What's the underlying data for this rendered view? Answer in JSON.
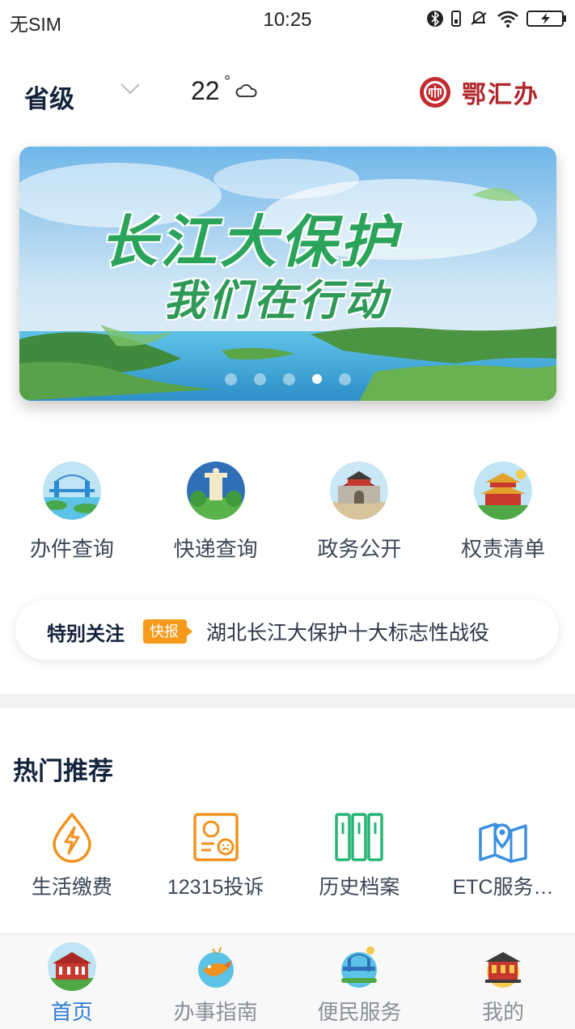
{
  "status_bar": {
    "carrier": "无SIM",
    "time": "10:25"
  },
  "header": {
    "region": "省级",
    "temperature": "22",
    "temperature_unit": "°",
    "weather_icon": "cloud-icon",
    "logo_text": "鄂汇办"
  },
  "banner": {
    "line1": "长江大保护",
    "line2": "我们在行动",
    "dot_count": 5,
    "active_dot": 4
  },
  "quick_services": [
    {
      "label": "办件查询",
      "icon": "bridge-illustration-icon"
    },
    {
      "label": "快递查询",
      "icon": "monument-illustration-icon"
    },
    {
      "label": "政务公开",
      "icon": "city-gate-illustration-icon"
    },
    {
      "label": "权责清单",
      "icon": "pavilion-illustration-icon"
    }
  ],
  "notice": {
    "label": "特别关注",
    "badge": "快报",
    "text": "湖北长江大保护十大标志性战役"
  },
  "hot_section": {
    "title": "热门推荐",
    "items": [
      {
        "label": "生活缴费",
        "icon": "utility-bolt-icon",
        "color": "#f0921f"
      },
      {
        "label": "12315投诉",
        "icon": "complaint-certificate-icon",
        "color": "#f0921f"
      },
      {
        "label": "历史档案",
        "icon": "archive-binders-icon",
        "color": "#27b573"
      },
      {
        "label": "ETC服务…",
        "icon": "map-pin-icon",
        "color": "#3b8fe0"
      }
    ]
  },
  "tab_bar": {
    "active_index": 0,
    "active_color": "#2e7bd6",
    "items": [
      {
        "label": "首页",
        "icon": "home-building-icon"
      },
      {
        "label": "办事指南",
        "icon": "guide-crane-icon"
      },
      {
        "label": "便民服务",
        "icon": "service-bridge-icon"
      },
      {
        "label": "我的",
        "icon": "profile-gate-icon"
      }
    ]
  }
}
